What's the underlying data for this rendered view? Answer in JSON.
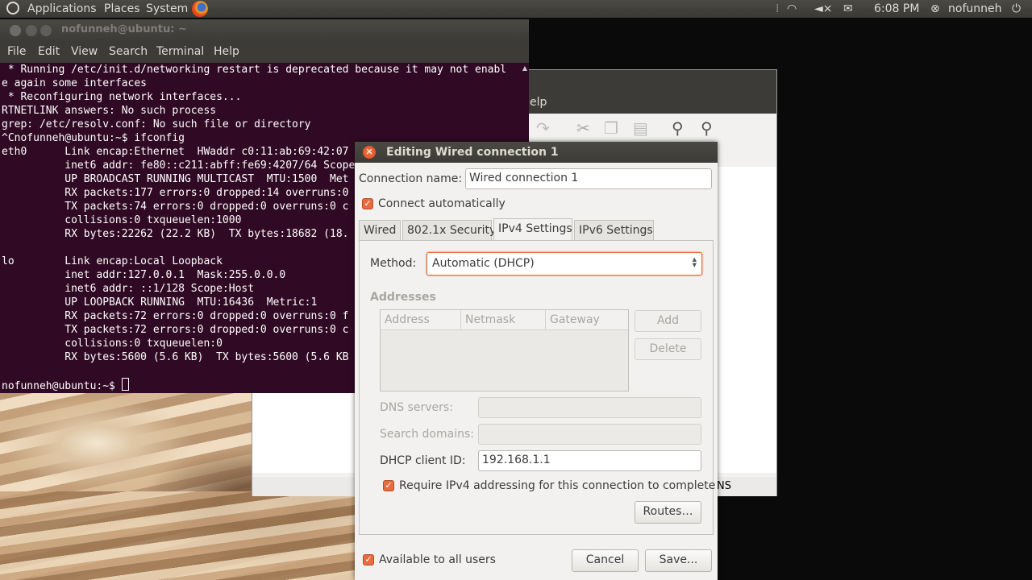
{
  "panel": {
    "menus": [
      "Applications",
      "Places",
      "System"
    ],
    "time": "6:08 PM",
    "user": "nofunneh"
  },
  "terminal": {
    "title": "nofunneh@ubuntu: ~",
    "menu": [
      "File",
      "Edit",
      "View",
      "Search",
      "Terminal",
      "Help"
    ],
    "lines": [
      " * Running /etc/init.d/networking restart is deprecated because it may not enabl",
      "e again some interfaces",
      " * Reconfiguring network interfaces...",
      "RTNETLINK answers: No such process",
      "grep: /etc/resolv.conf: No such file or directory",
      "^Cnofunneh@ubuntu:~$ ifconfig",
      "eth0      Link encap:Ethernet  HWaddr c0:11:ab:69:42:07",
      "          inet6 addr: fe80::c211:abff:fe69:4207/64 Scope",
      "          UP BROADCAST RUNNING MULTICAST  MTU:1500  Met",
      "          RX packets:177 errors:0 dropped:14 overruns:0",
      "          TX packets:74 errors:0 dropped:0 overruns:0 c",
      "          collisions:0 txqueuelen:1000",
      "          RX bytes:22262 (22.2 KB)  TX bytes:18682 (18.",
      "",
      "lo        Link encap:Local Loopback",
      "          inet addr:127.0.0.1  Mask:255.0.0.0",
      "          inet6 addr: ::1/128 Scope:Host",
      "          UP LOOPBACK RUNNING  MTU:16436  Metric:1",
      "          RX packets:72 errors:0 dropped:0 overruns:0 f",
      "          TX packets:72 errors:0 dropped:0 overruns:0 c",
      "          collisions:0 txqueuelen:0",
      "          RX bytes:5600 (5.6 KB)  TX bytes:5600 (5.6 KB",
      ""
    ],
    "prompt": "nofunneh@ubuntu:~$ "
  },
  "background_window": {
    "menu_fragment": "elp",
    "status_fragment": "NS"
  },
  "dialog": {
    "title": "Editing Wired connection 1",
    "connection_name_label": "Connection name:",
    "connection_name_value": "Wired connection 1",
    "connect_automatically": "Connect automatically",
    "tabs": [
      "Wired",
      "802.1x Security",
      "IPv4 Settings",
      "IPv6 Settings"
    ],
    "method_label": "Method:",
    "method_value": "Automatic (DHCP)",
    "addresses_label": "Addresses",
    "columns": [
      "Address",
      "Netmask",
      "Gateway"
    ],
    "add_button": "Add",
    "delete_button": "Delete",
    "dns_label": "DNS servers:",
    "search_domains_label": "Search domains:",
    "dhcp_client_id_label": "DHCP client ID:",
    "dhcp_client_id_value": "192.168.1.1",
    "require_ipv4": "Require IPv4 addressing for this connection to complete",
    "routes_button": "Routes…",
    "available_all_users": "Available to all users",
    "cancel_button": "Cancel",
    "save_button": "Save..."
  },
  "colors": {
    "terminal_bg": "#300a24",
    "ubuntu_orange": "#e66b3e",
    "panel_bg": "#3c3b37"
  }
}
